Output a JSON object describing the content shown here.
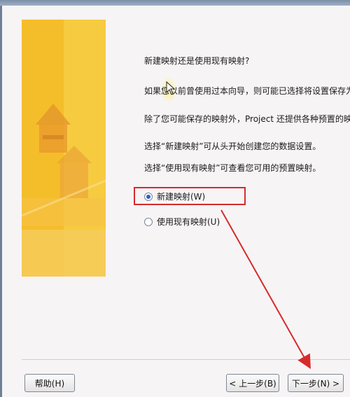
{
  "window": {
    "title": ""
  },
  "content": {
    "question": "新建映射还是使用现有映射?",
    "line1": "如果您以前曾使用过本向导，则可能已选择将设置保存为一",
    "line2": "除了您可能保存的映射外，Project 还提供各种预置的映射",
    "line3": "选择“新建映射”可从头开始创建您的数据设置。",
    "line4": "选择“使用现有映射”可查看您可用的预置映射。"
  },
  "options": [
    {
      "label": "新建映射(W)",
      "checked": true
    },
    {
      "label": "使用现有映射(U)",
      "checked": false
    }
  ],
  "buttons": {
    "help": "帮助(H)",
    "prev": "< 上一步(B)",
    "next": "下一步(N) >"
  },
  "colors": {
    "annotation_red": "#d62b2b",
    "banner_yellow": "#f4c63a",
    "radio_blue": "#2b62c2"
  }
}
